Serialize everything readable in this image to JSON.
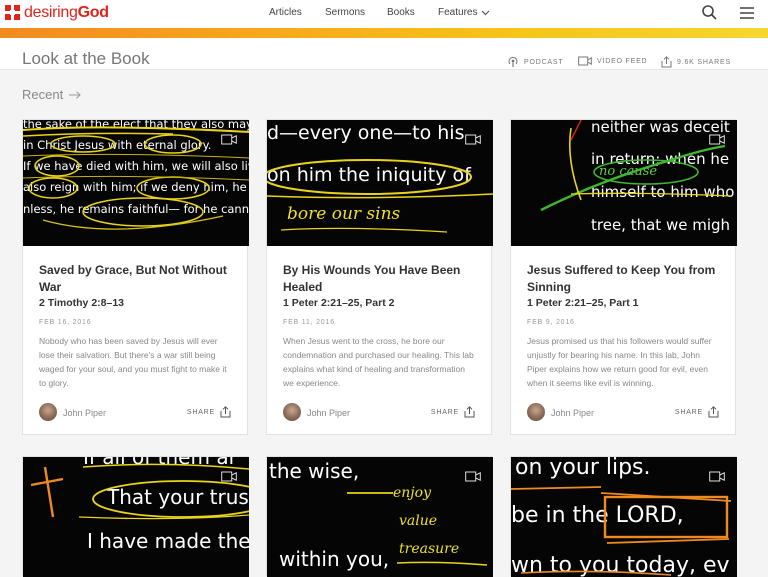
{
  "brand": {
    "logo_prefix": "desiring",
    "logo_suffix": "God",
    "color": "#e2231a"
  },
  "nav": {
    "items": [
      "Articles",
      "Sermons",
      "Books"
    ],
    "features": "Features"
  },
  "header": {
    "title": "Look at the Book",
    "podcast": "PODCAST",
    "video_feed": "VIDEO FEED",
    "shares": "9.6K SHARES"
  },
  "section": {
    "recent": "Recent"
  },
  "cards": [
    {
      "title": "Saved by Grace, But Not Without War",
      "scripture": "2 Timothy 2:8–13",
      "date": "FEB 16, 2016",
      "desc": "Nobody who has been saved by Jesus will ever lose their salvation. But there's a war still being waged for your soul, and you must fight to make it to glory.",
      "author": "John Piper",
      "share": "SHARE",
      "thumb_lines": [
        "the sake of the elect that they also may obt",
        "in Christ Jesus with eternal glory.",
        "If we have died with him, we will also live w",
        "also reign with him; if we deny him, he also",
        "nless, he remains faithful— for he cannot de"
      ]
    },
    {
      "title": "By His Wounds You Have Been Healed",
      "scripture": "1 Peter 2:21–25, Part 2",
      "date": "FEB 11, 2016",
      "desc": "When Jesus went to the cross, he bore our condemnation and purchased our healing. This lab explains what kind of healing and transformation we experience.",
      "author": "John Piper",
      "share": "SHARE",
      "thumb_lines": [
        "d—every one—to his",
        "on him the iniquity of"
      ],
      "handwriting": "bore our sins"
    },
    {
      "title": "Jesus Suffered to Keep You from Sinning",
      "scripture": "1 Peter 2:21–25, Part 1",
      "date": "FEB 9, 2016",
      "desc": "Jesus promised us that his followers would suffer unjustly for bearing his name. In this lab, John Piper explains how we return good for evil, even when it seems like evil is winning.",
      "author": "John Piper",
      "share": "SHARE",
      "thumb_lines": [
        "neither was deceit",
        "in return; when he",
        "himself to him who",
        "tree, that we migh"
      ],
      "handwriting": "no cause"
    },
    {
      "thumb_lines": [
        "If all of them ar",
        "That your trus",
        "I have made the"
      ]
    },
    {
      "thumb_lines": [
        "the wise,",
        "within you,"
      ],
      "handwriting": [
        "enjoy",
        "value",
        "treasure"
      ]
    },
    {
      "thumb_lines": [
        "on your lips.",
        "be in the LORD,",
        "wn to you today, ev"
      ]
    }
  ]
}
